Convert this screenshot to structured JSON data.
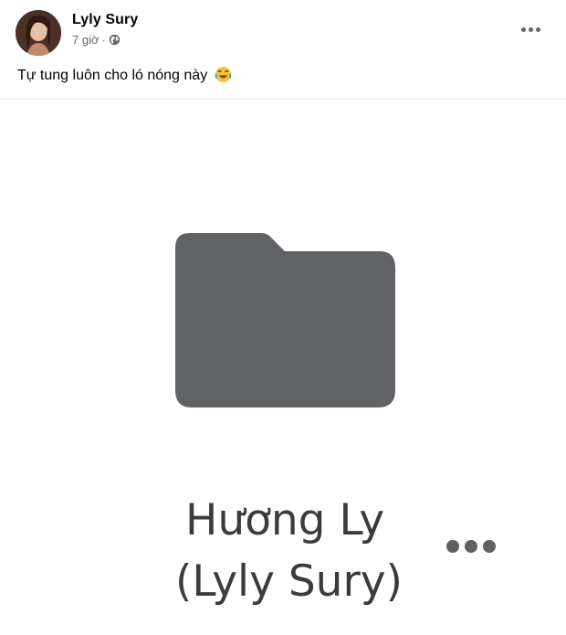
{
  "post": {
    "author": "Lyly Sury",
    "time": "7 giờ",
    "separator": "·",
    "privacy_icon": "globe-icon",
    "text": "Tự tung luôn cho ló nóng này",
    "emoji": "laughing-crying-emoji"
  },
  "media": {
    "icon": "folder-icon",
    "folder_name_line1": "Hương Ly",
    "folder_name_line2": "(Lyly Sury)",
    "folder_color": "#616266"
  },
  "colors": {
    "text_primary": "#050505",
    "text_secondary": "#65676b",
    "divider": "#e4e6eb"
  }
}
